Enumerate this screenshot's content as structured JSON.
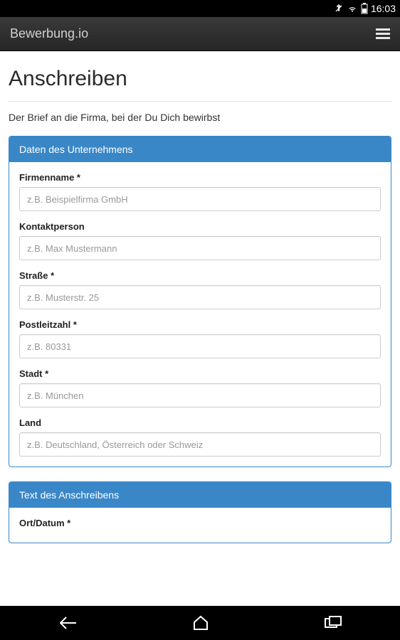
{
  "status": {
    "time": "16:03"
  },
  "header": {
    "title": "Bewerbung.io"
  },
  "page": {
    "heading": "Anschreiben",
    "subtitle": "Der Brief an die Firma, bei der Du Dich bewirbst"
  },
  "panel1": {
    "title": "Daten des Unternehmens",
    "fields": [
      {
        "label": "Firmenname *",
        "placeholder": "z.B. Beispielfirma GmbH"
      },
      {
        "label": "Kontaktperson",
        "placeholder": "z.B. Max Mustermann"
      },
      {
        "label": "Straße *",
        "placeholder": "z.B. Musterstr. 25"
      },
      {
        "label": "Postleitzahl *",
        "placeholder": "z.B. 80331"
      },
      {
        "label": "Stadt *",
        "placeholder": "z.B. München"
      },
      {
        "label": "Land",
        "placeholder": "z.B. Deutschland, Österreich oder Schweiz"
      }
    ]
  },
  "panel2": {
    "title": "Text des Anschreibens",
    "fields": [
      {
        "label": "Ort/Datum *"
      }
    ]
  }
}
